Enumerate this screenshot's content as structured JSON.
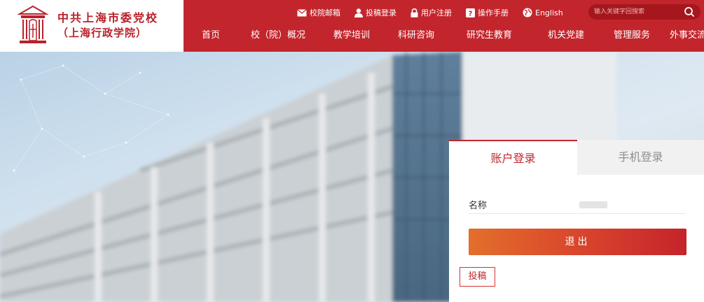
{
  "logo": {
    "line1": "中共上海市委党校",
    "line2": "（上海行政学院）"
  },
  "toplinks": [
    {
      "icon": "mail-icon",
      "label": "校院邮箱"
    },
    {
      "icon": "person-icon",
      "label": "投稿登录"
    },
    {
      "icon": "lock-icon",
      "label": "用户注册"
    },
    {
      "icon": "help-icon",
      "label": "操作手册"
    },
    {
      "icon": "globe-icon",
      "label": "English"
    }
  ],
  "search": {
    "placeholder": "输入关键字回搜索"
  },
  "nav": [
    {
      "label": "首页"
    },
    {
      "label": "校（院）概况"
    },
    {
      "label": "教学培训"
    },
    {
      "label": "科研咨询"
    },
    {
      "label": "研究生教育"
    },
    {
      "label": "机关党建"
    },
    {
      "label": "管理服务"
    },
    {
      "label": "外事交流"
    }
  ],
  "login": {
    "tabs": [
      {
        "label": "账户登录",
        "active": true
      },
      {
        "label": "手机登录",
        "active": false
      }
    ],
    "name_label": "名称",
    "logout_label": "退出",
    "submit_label": "投稿"
  },
  "colors": {
    "brand_red": "#c3252c",
    "button_gradient_start": "#e36f2b",
    "button_gradient_end": "#c5242b"
  }
}
